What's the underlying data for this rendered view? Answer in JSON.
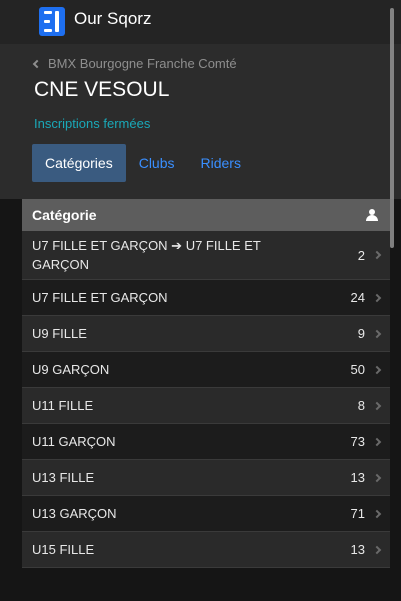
{
  "app": {
    "title": "Our Sqorz",
    "brand_color": "#1e6ff0"
  },
  "header": {
    "breadcrumb": "BMX Bourgogne Franche Comté",
    "title": "CNE VESOUL",
    "status": "Inscriptions fermées",
    "status_color": "#1aa8b8"
  },
  "tabs": [
    {
      "label": "Catégories",
      "active": true
    },
    {
      "label": "Clubs",
      "active": false
    },
    {
      "label": "Riders",
      "active": false
    }
  ],
  "table": {
    "header_label": "Catégorie",
    "header_icon": "person-icon",
    "rows": [
      {
        "category": "U7 FILLE ET GARÇON ➔ U7 FILLE ET GARÇON",
        "count": "2"
      },
      {
        "category": "U7 FILLE ET GARÇON",
        "count": "24"
      },
      {
        "category": "U9 FILLE",
        "count": "9"
      },
      {
        "category": "U9 GARÇON",
        "count": "50"
      },
      {
        "category": "U11 FILLE",
        "count": "8"
      },
      {
        "category": "U11 GARÇON",
        "count": "73"
      },
      {
        "category": "U13 FILLE",
        "count": "13"
      },
      {
        "category": "U13 GARÇON",
        "count": "71"
      },
      {
        "category": "U15 FILLE",
        "count": "13"
      }
    ]
  }
}
